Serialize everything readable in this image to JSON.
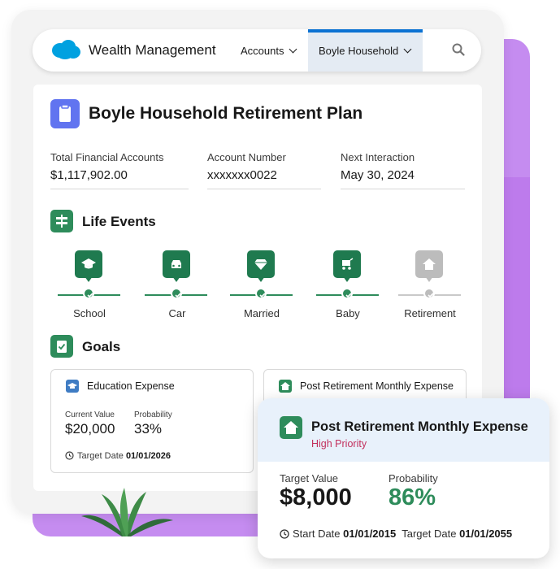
{
  "colors": {
    "accent_blue": "#0b72d3",
    "event_green": "#2e8c5b",
    "priority_red": "#c2305d",
    "backdrop_purple": "#c58cf0",
    "plan_icon": "#6174f0"
  },
  "navbar": {
    "app_title": "Wealth Management",
    "accounts_label": "Accounts",
    "active_tab_label": "Boyle Household",
    "icons": {
      "logo": "cloud-logo",
      "search": "search-icon"
    }
  },
  "header": {
    "title": "Boyle Household Retirement Plan",
    "icon": "clipboard-icon"
  },
  "summary_fields": [
    {
      "label": "Total Financial Accounts",
      "value": "$1,117,902.00"
    },
    {
      "label": "Account Number",
      "value": "xxxxxxx0022"
    },
    {
      "label": "Next Interaction",
      "value": "May 30, 2024"
    }
  ],
  "life_events": {
    "title": "Life Events",
    "items": [
      {
        "label": "School",
        "icon": "graduation-cap-icon",
        "status": "complete"
      },
      {
        "label": "Car",
        "icon": "car-icon",
        "status": "complete"
      },
      {
        "label": "Married",
        "icon": "diamond-icon",
        "status": "complete"
      },
      {
        "label": "Baby",
        "icon": "stroller-icon",
        "status": "complete"
      },
      {
        "label": "Retirement",
        "icon": "home-icon",
        "status": "pending"
      }
    ]
  },
  "goals": {
    "title": "Goals",
    "cards": [
      {
        "title": "Education Expense",
        "current_value_label": "Current Value",
        "current_value": "$20,000",
        "probability_label": "Probability",
        "probability": "33%",
        "target_date_label": "Target Date",
        "target_date": "01/01/2026"
      },
      {
        "title": "Post Retirement Monthly Expense"
      }
    ]
  },
  "popup": {
    "title": "Post Retirement Monthly Expense",
    "priority": "High Priority",
    "target_value_label": "Target Value",
    "target_value": "$8,000",
    "probability_label": "Probability",
    "probability": "86%",
    "start_date_label": "Start Date",
    "start_date": "01/01/2015",
    "target_date_label": "Target Date",
    "target_date": "01/01/2055"
  }
}
